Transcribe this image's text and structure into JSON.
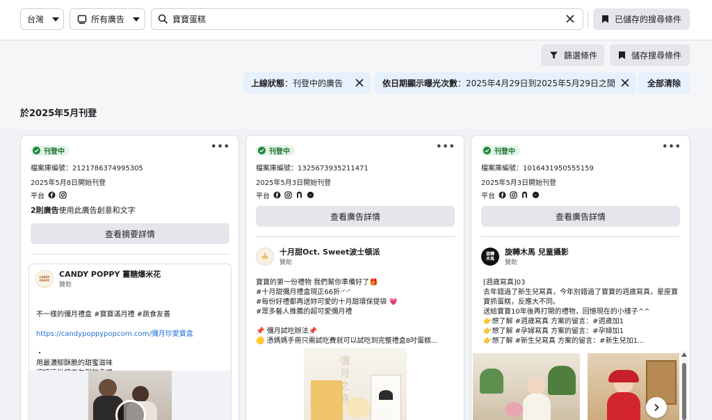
{
  "top": {
    "country": "台灣",
    "ad_type": "所有廣告",
    "search_value": "寶寶蛋糕",
    "saved_searches": "已儲存的搜尋條件"
  },
  "filters": {
    "filter_button": "篩選條件",
    "save_search_button": "儲存搜尋條件",
    "chip1_label": "上線狀態",
    "chip1_value": "：刊登中的廣告",
    "chip2_label": "依日期顯示曝光次數",
    "chip2_value": "：2025年4月29日到2025年5月29日之間",
    "clear_all": "全部清除"
  },
  "section_title": "於2025年5月刊登",
  "cards": [
    {
      "status": "刊登中",
      "library_id": "檔案庫編號：2121786374995305",
      "start_date": "2025年5月8日開始刊登",
      "platform_label": "平台",
      "related_bold": "2則廣告",
      "related_rest": "使用此廣告創意和文字",
      "detail_button": "查看摘要詳情",
      "advertiser": "CANDY POPPY 薑糖爆米花",
      "avatar_text": "CANDY POPPY",
      "sponsored": "贊助",
      "text_line1": "不一樣的彌月禮盒 #寶寶滿月禮 #蔬食友善",
      "link": "https://candypoppypopcorn.com/彌月珍愛寶盒",
      "text_rest": "・\n用最濃郁酥脆的甜蜜滋味\n迎接這份初來乍到的幸福\n向世界訴說喜悅💝\n・..."
    },
    {
      "status": "刊登中",
      "library_id": "檔案庫編號：1325673935211471",
      "start_date": "2025年5月3日開始刊登",
      "platform_label": "平台",
      "detail_button": "查看廣告詳情",
      "advertiser": "十月甜Oct. Sweet波士頓派",
      "sponsored": "贊助",
      "text": "寶寶的第一份禮物 我們幫你準備好了🎁\n#十月甜彌月禮盒現正66折·ᐟ·ᐟ\n#每份好禮都再送妳可愛的十月甜環保提袋 💗\n#眾多藝人推薦的超可愛彌月禮\n\n📌 彌月試吃辦法📌\n🟡 憑媽媽手冊只需試吃費就可以試吃到完整禮盒8吋蛋糕...",
      "media_text": "彌月之喜"
    },
    {
      "status": "刊登中",
      "library_id": "檔案庫編號：1016431950555159",
      "start_date": "2025年5月3日開始刊登",
      "platform_label": "平台",
      "detail_button": "查看廣告詳情",
      "advertiser": "旋轉木馬 兒童攝影",
      "avatar_text": "旋轉木馬",
      "sponsored": "贊助",
      "text": "[週歲寫真]03\n去年錯過了新生兒寫真，今年別錯過了寶寶的週歲寫真，星座寶寶抓蛋糕，反應大不同。\n送給寶寶10年後再打開的禮物，回憶現在的小樣子^^\n👉想了解 #週歲寫真 方案的留言：#週歲加1\n👉想了解 #孕婦寫真 方案的留言：#孕婦加1\n👉想了解 #新生兒寫真 方案的留言：#新生兒加1..."
    }
  ],
  "colors": {
    "chip_bg": "#e7f0fd",
    "button_grey": "#e4e6eb",
    "status_green": "#1f8a3d",
    "link_blue": "#216fdb"
  }
}
